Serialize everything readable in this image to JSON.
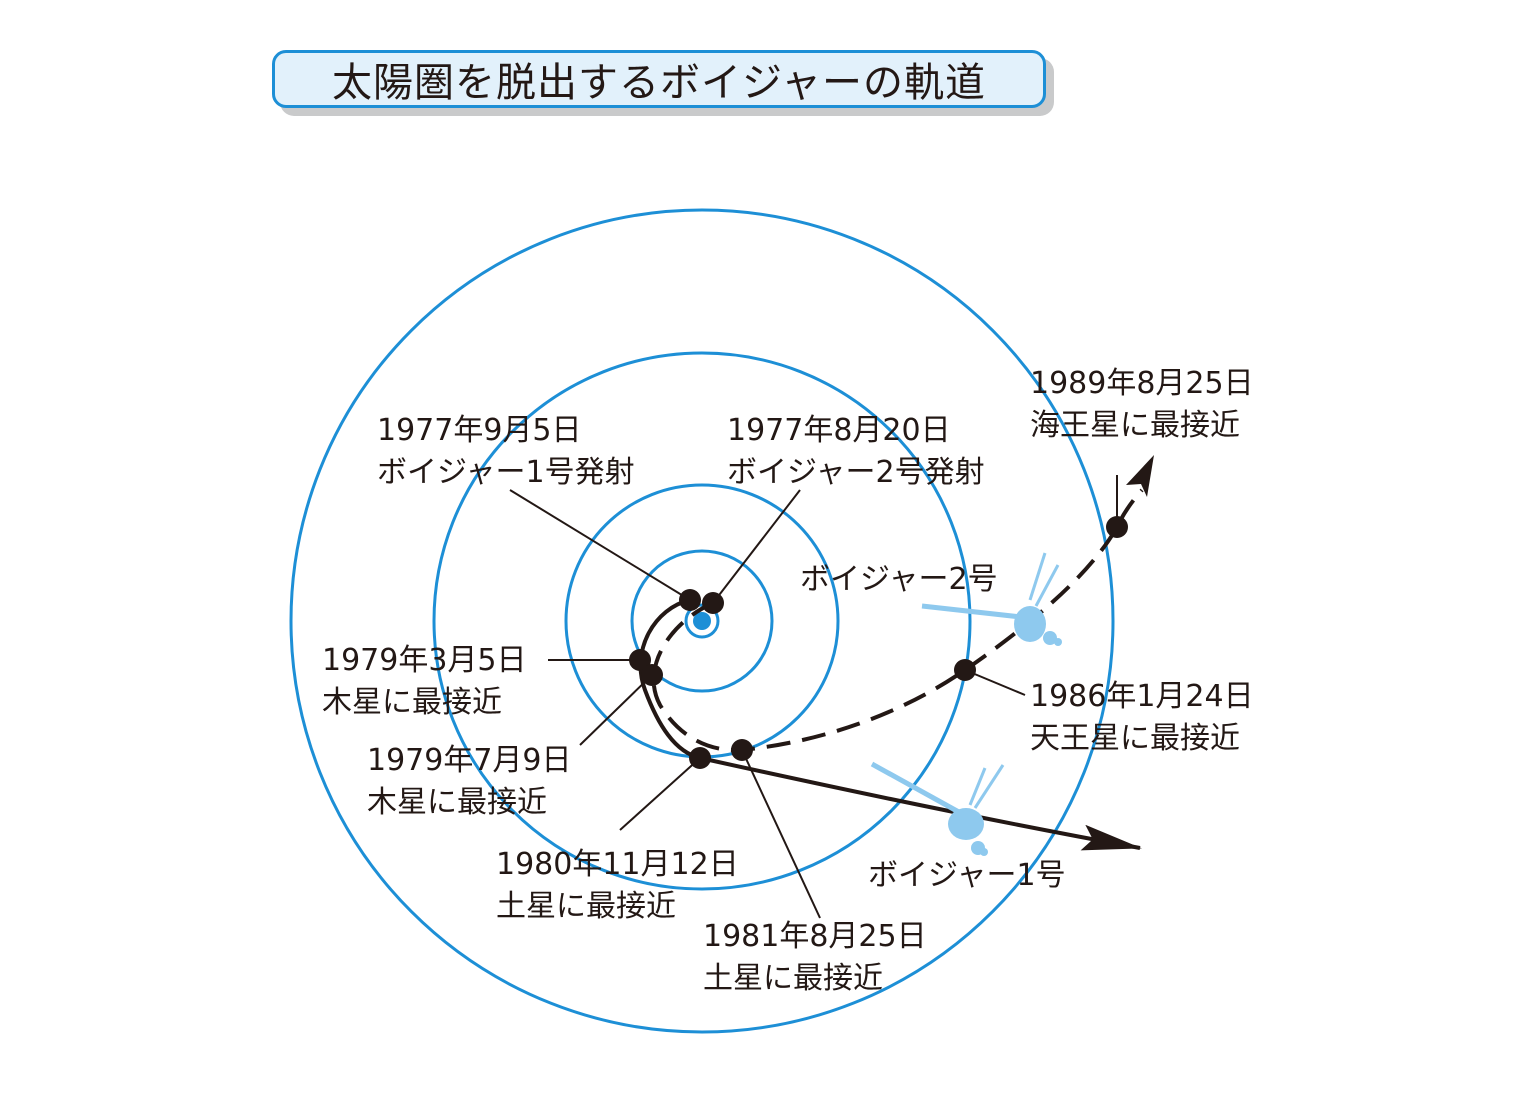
{
  "title": "太陽圏を脱出するボイジャーの軌道",
  "spacecraft": {
    "voyager1": "ボイジャー1号",
    "voyager2": "ボイジャー2号"
  },
  "events": {
    "v1_launch": {
      "date": "1977年9月5日",
      "event": "ボイジャー1号発射"
    },
    "v2_launch": {
      "date": "1977年8月20日",
      "event": "ボイジャー2号発射"
    },
    "v1_jupiter": {
      "date": "1979年3月5日",
      "event": "木星に最接近"
    },
    "v2_jupiter": {
      "date": "1979年7月9日",
      "event": "木星に最接近"
    },
    "v1_saturn": {
      "date": "1980年11月12日",
      "event": "土星に最接近"
    },
    "v2_saturn": {
      "date": "1981年8月25日",
      "event": "土星に最接近"
    },
    "v2_uranus": {
      "date": "1986年1月24日",
      "event": "天王星に最接近"
    },
    "v2_neptune": {
      "date": "1989年8月25日",
      "event": "海王星に最接近"
    }
  },
  "colors": {
    "orbit": "#1d8fd6",
    "sun": "#1d8fd6",
    "trajectory": "#231815",
    "spacecraft": "#8ec9ee",
    "title_bg": "#e2f1fb"
  }
}
